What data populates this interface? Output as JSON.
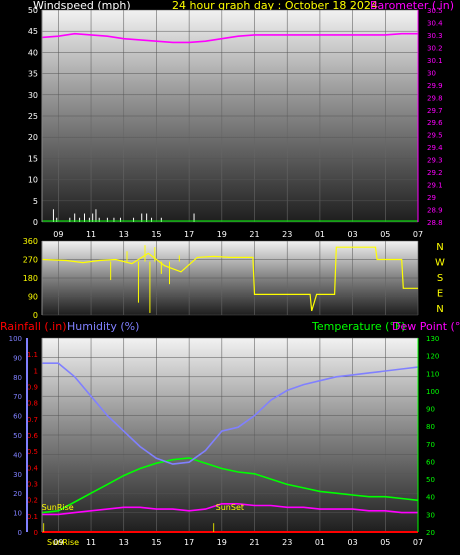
{
  "header": {
    "title": "24 hour graph day : October 18 2024",
    "wind_label": "Windspeed (mph)",
    "baro_label": "Barometer (.in)"
  },
  "x_ticks": [
    "09",
    "11",
    "13",
    "15",
    "17",
    "19",
    "21",
    "23",
    "01",
    "03",
    "05",
    "07"
  ],
  "x_ticks_bottom": [
    "09",
    "11",
    "13",
    "15",
    "17",
    "19",
    "21",
    "23",
    "01",
    "03",
    "05",
    "07"
  ],
  "sunrise_label": "SunRise",
  "sunrise_marker": "SunRise",
  "sunset_marker": "SunSet",
  "compass": [
    "N",
    "W",
    "S",
    "E",
    "N"
  ],
  "bottom_labels": {
    "rain": "Rainfall (.in)",
    "humidity": "Humidity (%)",
    "temp": "Temperature (°F)",
    "dew": "Dew Point (°F)"
  },
  "colors": {
    "title": "#ffff00",
    "baro": "#ff00ff",
    "wind": "#ffffff",
    "winddir": "#ffff00",
    "rain": "#ff0000",
    "humidity": "#8080ff",
    "temp": "#00ff00",
    "dew": "#ff00ff"
  },
  "chart_data": [
    {
      "type": "line",
      "id": "wind-baro",
      "title": "24 hour graph day : October 18 2024",
      "x_ticks": [
        "09",
        "11",
        "13",
        "15",
        "17",
        "19",
        "21",
        "23",
        "01",
        "03",
        "05",
        "07"
      ],
      "left_axis": {
        "label": "Windspeed (mph)",
        "ticks": [
          0,
          5,
          10,
          15,
          20,
          25,
          30,
          35,
          40,
          45,
          50
        ],
        "ylim": [
          0,
          50
        ]
      },
      "right_axis": {
        "label": "Barometer (.in)",
        "ticks": [
          "28.8",
          "28.9",
          "29",
          "29.1",
          "29.2",
          "29.3",
          "29.4",
          "29.5",
          "29.6",
          "29.7",
          "29.8",
          "29.9",
          "30",
          "30.1",
          "30.2",
          "30.3",
          "30.4",
          "30.5"
        ],
        "ylim": [
          28.8,
          30.5
        ]
      },
      "series": [
        {
          "name": "Barometer (.in)",
          "axis": "right",
          "color": "#ff00ff",
          "points": [
            [
              8.0,
              30.28
            ],
            [
              9.0,
              30.29
            ],
            [
              10.0,
              30.31
            ],
            [
              11.0,
              30.3
            ],
            [
              12.0,
              30.29
            ],
            [
              13.0,
              30.27
            ],
            [
              14.0,
              30.26
            ],
            [
              15.0,
              30.25
            ],
            [
              16.0,
              30.24
            ],
            [
              17.0,
              30.24
            ],
            [
              18.0,
              30.25
            ],
            [
              19.0,
              30.27
            ],
            [
              20.0,
              30.29
            ],
            [
              21.0,
              30.3
            ],
            [
              22.0,
              30.3
            ],
            [
              23.0,
              30.3
            ],
            [
              24.0,
              30.3
            ],
            [
              25.0,
              30.3
            ],
            [
              26.0,
              30.3
            ],
            [
              27.0,
              30.3
            ],
            [
              28.0,
              30.3
            ],
            [
              29.0,
              30.3
            ],
            [
              30.0,
              30.31
            ],
            [
              31.0,
              30.31
            ]
          ]
        },
        {
          "name": "Windspeed (mph)",
          "axis": "left",
          "color": "#ffffff",
          "bars": [
            [
              8.7,
              3
            ],
            [
              8.9,
              1
            ],
            [
              9.7,
              1
            ],
            [
              10.0,
              2
            ],
            [
              10.3,
              1
            ],
            [
              10.6,
              2
            ],
            [
              10.9,
              1
            ],
            [
              11.1,
              2
            ],
            [
              11.3,
              3
            ],
            [
              11.5,
              1
            ],
            [
              12.0,
              1
            ],
            [
              12.4,
              1
            ],
            [
              12.8,
              1
            ],
            [
              13.6,
              1
            ],
            [
              14.1,
              2
            ],
            [
              14.4,
              2
            ],
            [
              14.7,
              1
            ],
            [
              15.3,
              1
            ],
            [
              17.3,
              2
            ]
          ]
        }
      ]
    },
    {
      "type": "line",
      "id": "wind-direction",
      "x_ticks": [
        "09",
        "11",
        "13",
        "15",
        "17",
        "19",
        "21",
        "23",
        "01",
        "03",
        "05",
        "07"
      ],
      "left_axis": {
        "ticks": [
          0,
          90,
          180,
          270,
          360
        ],
        "ylim": [
          0,
          360
        ]
      },
      "right_axis": {
        "ticks": [
          "N",
          "W",
          "S",
          "E",
          "N"
        ]
      },
      "series": [
        {
          "name": "Wind direction",
          "color": "#ffff00",
          "points": [
            [
              8.0,
              270
            ],
            [
              9.5,
              265
            ],
            [
              10.5,
              255
            ],
            [
              11.5,
              265
            ],
            [
              12.5,
              270
            ],
            [
              13.5,
              250
            ],
            [
              14.5,
              300
            ],
            [
              15.5,
              240
            ],
            [
              16.5,
              210
            ],
            [
              17.5,
              280
            ],
            [
              18.5,
              285
            ],
            [
              19.5,
              280
            ],
            [
              20.9,
              280
            ],
            [
              21.0,
              100
            ],
            [
              24.4,
              100
            ],
            [
              24.5,
              20
            ],
            [
              24.8,
              100
            ],
            [
              25.9,
              100
            ],
            [
              26.0,
              330
            ],
            [
              28.4,
              330
            ],
            [
              28.5,
              270
            ],
            [
              30.0,
              270
            ],
            [
              30.1,
              130
            ],
            [
              31.0,
              130
            ]
          ]
        }
      ]
    },
    {
      "type": "line",
      "id": "temp-humidity",
      "x_ticks": [
        "09",
        "11",
        "13",
        "15",
        "17",
        "19",
        "21",
        "23",
        "01",
        "03",
        "05",
        "07"
      ],
      "rain_axis": {
        "label": "Rainfall (.in)",
        "ticks": [
          "0",
          "0.1",
          "0.2",
          "0.3",
          "0.4",
          "0.5",
          "0.6",
          "0.7",
          "0.8",
          "0.9",
          "1",
          "1.1"
        ],
        "ylim": [
          0,
          1.2
        ]
      },
      "humidity_axis": {
        "label": "Humidity (%)",
        "ticks": [
          0,
          10,
          20,
          30,
          40,
          50,
          60,
          70,
          80,
          90,
          100
        ],
        "ylim": [
          0,
          100
        ]
      },
      "temp_axis": {
        "label": "Temperature (°F)",
        "ticks": [
          20,
          30,
          40,
          50,
          60,
          70,
          80,
          90,
          100,
          110,
          120,
          130
        ],
        "ylim": [
          20,
          130
        ]
      },
      "series": [
        {
          "name": "Humidity (%)",
          "color": "#8080ff",
          "points": [
            [
              8.0,
              87
            ],
            [
              9.0,
              87
            ],
            [
              10.0,
              80
            ],
            [
              11.0,
              70
            ],
            [
              12.0,
              60
            ],
            [
              13.0,
              52
            ],
            [
              14.0,
              44
            ],
            [
              15.0,
              38
            ],
            [
              16.0,
              35
            ],
            [
              17.0,
              36
            ],
            [
              18.0,
              42
            ],
            [
              19.0,
              52
            ],
            [
              20.0,
              54
            ],
            [
              21.0,
              60
            ],
            [
              22.0,
              68
            ],
            [
              23.0,
              73
            ],
            [
              24.0,
              76
            ],
            [
              25.0,
              78
            ],
            [
              26.0,
              80
            ],
            [
              27.0,
              81
            ],
            [
              28.0,
              82
            ],
            [
              29.0,
              83
            ],
            [
              30.0,
              84
            ],
            [
              31.0,
              85
            ]
          ]
        },
        {
          "name": "Temperature (°F)",
          "color": "#00ff00",
          "points": [
            [
              8.0,
              31
            ],
            [
              9.0,
              32
            ],
            [
              10.0,
              37
            ],
            [
              11.0,
              42
            ],
            [
              12.0,
              47
            ],
            [
              13.0,
              52
            ],
            [
              14.0,
              56
            ],
            [
              15.0,
              59
            ],
            [
              16.0,
              61
            ],
            [
              17.0,
              62
            ],
            [
              18.0,
              59
            ],
            [
              19.0,
              56
            ],
            [
              20.0,
              54
            ],
            [
              21.0,
              53
            ],
            [
              22.0,
              50
            ],
            [
              23.0,
              47
            ],
            [
              24.0,
              45
            ],
            [
              25.0,
              43
            ],
            [
              26.0,
              42
            ],
            [
              27.0,
              41
            ],
            [
              28.0,
              40
            ],
            [
              29.0,
              40
            ],
            [
              30.0,
              39
            ],
            [
              31.0,
              38
            ]
          ]
        },
        {
          "name": "Dew Point (°F)",
          "color": "#ff00ff",
          "points": [
            [
              8.0,
              30
            ],
            [
              9.0,
              30
            ],
            [
              10.0,
              31
            ],
            [
              11.0,
              32
            ],
            [
              12.0,
              33
            ],
            [
              13.0,
              34
            ],
            [
              14.0,
              34
            ],
            [
              15.0,
              33
            ],
            [
              16.0,
              33
            ],
            [
              17.0,
              32
            ],
            [
              18.0,
              33
            ],
            [
              19.0,
              36
            ],
            [
              20.0,
              36
            ],
            [
              21.0,
              35
            ],
            [
              22.0,
              35
            ],
            [
              23.0,
              34
            ],
            [
              24.0,
              34
            ],
            [
              25.0,
              33
            ],
            [
              26.0,
              33
            ],
            [
              27.0,
              33
            ],
            [
              28.0,
              32
            ],
            [
              29.0,
              32
            ],
            [
              30.0,
              31
            ],
            [
              31.0,
              31
            ]
          ]
        },
        {
          "name": "Rainfall (.in)",
          "color": "#ff0000",
          "points": [
            [
              8.0,
              0
            ],
            [
              31.0,
              0
            ]
          ]
        }
      ],
      "markers": [
        {
          "label": "SunRise",
          "x": 8.1
        },
        {
          "label": "SunSet",
          "x": 18.5
        }
      ]
    }
  ]
}
